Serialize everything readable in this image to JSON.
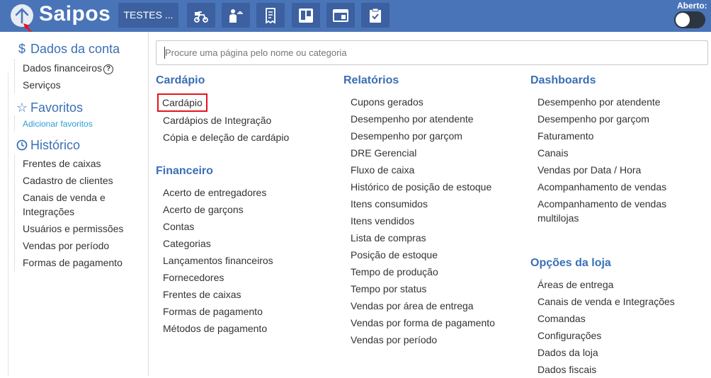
{
  "header": {
    "logo": "Saipos",
    "store_button": "TESTES ...",
    "open_label": "Aberto:",
    "tools": [
      "delivery-icon",
      "waiter-icon",
      "receipt-icon",
      "kanban-icon",
      "screen-icon",
      "clipboard-check-icon"
    ]
  },
  "sidebar": {
    "account": {
      "title": "Dados da conta",
      "items": [
        "Dados financeiros",
        "Serviços"
      ]
    },
    "favorites": {
      "title": "Favoritos",
      "add_link": "Adicionar favoritos"
    },
    "history": {
      "title": "Histórico",
      "items": [
        "Frentes de caixas",
        "Cadastro de clientes",
        "Canais de venda e Integrações",
        "Usuários e permissões",
        "Vendas por período",
        "Formas de pagamento"
      ]
    }
  },
  "search": {
    "placeholder": "Procure uma página pelo nome ou categoria"
  },
  "columns": {
    "cardapio": {
      "title": "Cardápio",
      "items": [
        "Cardápio",
        "Cardápios de Integração",
        "Cópia e deleção de cardápio"
      ]
    },
    "financeiro": {
      "title": "Financeiro",
      "items": [
        "Acerto de entregadores",
        "Acerto de garçons",
        "Contas",
        "Categorias",
        "Lançamentos financeiros",
        "Fornecedores",
        "Frentes de caixas",
        "Formas de pagamento",
        "Métodos de pagamento"
      ]
    },
    "relatorios": {
      "title": "Relatórios",
      "items": [
        "Cupons gerados",
        "Desempenho por atendente",
        "Desempenho por garçom",
        "DRE Gerencial",
        "Fluxo de caixa",
        "Histórico de posição de estoque",
        "Itens consumidos",
        "Itens vendidos",
        "Lista de compras",
        "Posição de estoque",
        "Tempo de produção",
        "Tempo por status",
        "Vendas por área de entrega",
        "Vendas por forma de pagamento",
        "Vendas por período"
      ]
    },
    "dashboards": {
      "title": "Dashboards",
      "items": [
        "Desempenho por atendente",
        "Desempenho por garçom",
        "Faturamento",
        "Canais",
        "Vendas por Data / Hora",
        "Acompanhamento de vendas",
        "Acompanhamento de vendas multilojas"
      ]
    },
    "opcoes": {
      "title": "Opções da loja",
      "items": [
        "Áreas de entrega",
        "Canais de venda e Integrações",
        "Comandas",
        "Configurações",
        "Dados da loja",
        "Dados fiscais"
      ]
    }
  },
  "colors": {
    "topbar": "#4a74b8",
    "accent": "#3a6fb6",
    "highlight": "#e5151a",
    "link": "#2a9fd6"
  }
}
